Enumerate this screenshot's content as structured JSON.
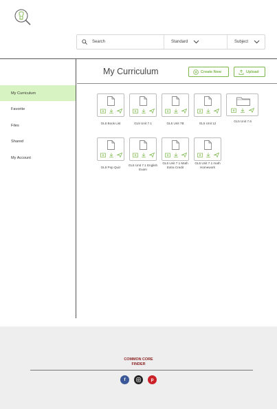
{
  "search": {
    "placeholder": "Search",
    "standard_label": "Standard",
    "subject_label": "Subject"
  },
  "sidebar": {
    "items": [
      {
        "label": "My Curriculum"
      },
      {
        "label": "Favorite"
      },
      {
        "label": "Files"
      },
      {
        "label": "Shared"
      },
      {
        "label": "My Account"
      }
    ]
  },
  "main": {
    "title": "My Curriculum",
    "create_label": "Create New",
    "upload_label": "Upload",
    "items": [
      {
        "label": "GL5 Book List",
        "type": "document"
      },
      {
        "label": "GL5 Unit 7.1",
        "type": "document"
      },
      {
        "label": "GL5 Unit 7B",
        "type": "document"
      },
      {
        "label": "GL5 Unit 12",
        "type": "document"
      },
      {
        "label": "GL5 Unit 7.6",
        "type": "folder"
      },
      {
        "label": "GL5 Pop Quiz",
        "type": "document"
      },
      {
        "label": "GL5 Unit 7.1 English Exam",
        "type": "document"
      },
      {
        "label": "GL5 Unit 7.1 Math Extra Credit",
        "type": "document"
      },
      {
        "label": "GL5 Unit 7.1 math Homework",
        "type": "document"
      }
    ]
  },
  "footer": {
    "brand_line1": "COMMON CORE",
    "brand_line2": "FINDER",
    "social": [
      "facebook-icon",
      "instagram-icon",
      "pinterest-icon"
    ]
  },
  "colors": {
    "accent": "#7ab648",
    "active_bg": "#d8f3c2",
    "brand": "#8b1f1f",
    "footer_bg": "#eeeeee"
  }
}
